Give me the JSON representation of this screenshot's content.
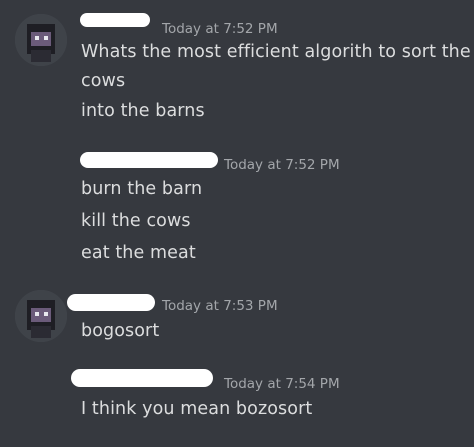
{
  "messages": [
    {
      "timestamp": "Today at 7:52 PM",
      "lines": [
        "Whats the most efficient algorith to sort the",
        "cows",
        "into the barns"
      ]
    },
    {
      "timestamp": "Today at 7:52 PM",
      "lines": [
        "burn the barn",
        "kill the cows",
        "eat the meat"
      ]
    },
    {
      "timestamp": "Today at 7:53 PM",
      "lines": [
        "bogosort"
      ]
    },
    {
      "timestamp": "Today at 7:54 PM",
      "lines": [
        "I think you mean bozosort"
      ]
    }
  ]
}
